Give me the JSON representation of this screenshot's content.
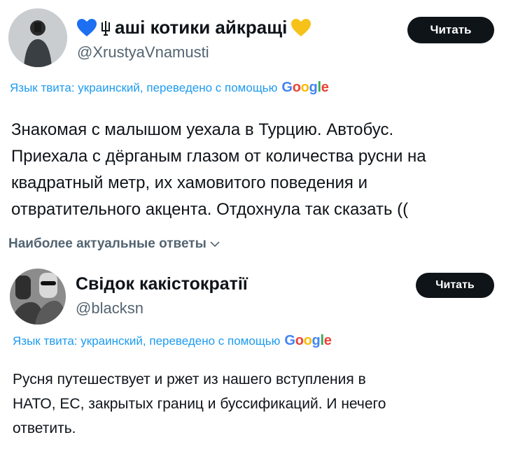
{
  "tweet": {
    "display_name": "аші котики айкращі",
    "handle": "@XrustyaVnamusti",
    "follow_label": "Читать",
    "translate_label": "Язык твита: украинский, переведено с помощью",
    "google_letters": [
      "G",
      "o",
      "o",
      "g",
      "l",
      "e"
    ],
    "body_lines": [
      "Знакомая с малышом уехала в Турцию. Автобус.",
      "Приехала с дёрганым глазом от количества русни на",
      "квадратный метр, их хамовитого поведения и",
      "отвратительного акцента. Отдохнула так сказать (("
    ]
  },
  "section_title": "Наиболее актуальные ответы",
  "reply": {
    "display_name": "Свідок какістократії",
    "handle": "@blacksn",
    "follow_label": "Читать",
    "translate_label": "Язык твита: украинский, переведено с помощью",
    "google_letters": [
      "G",
      "o",
      "o",
      "g",
      "l",
      "e"
    ],
    "body_lines": [
      "Русня путешествует и ржет из нашего вступления в",
      "НАТО, ЕС, закрытых границ и буссификаций. И нечего",
      "ответить."
    ]
  },
  "colors": {
    "blue_heart": "#1d6ff2",
    "yellow_heart": "#f6c21a",
    "link": "#1d9bf0",
    "follow_bg": "#0f1419"
  }
}
